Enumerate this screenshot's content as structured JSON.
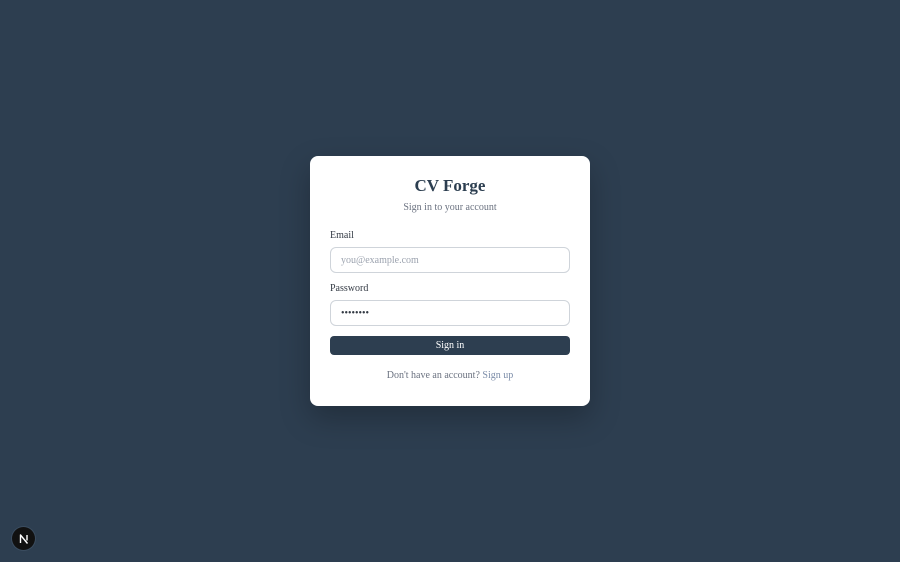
{
  "app": {
    "title": "CV Forge",
    "subtitle": "Sign in to your account"
  },
  "form": {
    "email": {
      "label": "Email",
      "placeholder": "you@example.com",
      "value": ""
    },
    "password": {
      "label": "Password",
      "value": "••••••••"
    },
    "submit_label": "Sign in"
  },
  "footer": {
    "prompt": "Don't have an account?",
    "link_label": "Sign up"
  },
  "dev_badge": {
    "icon": "nextjs-logo-icon",
    "letter": "N"
  },
  "colors": {
    "background": "#2d3e50",
    "card": "#ffffff",
    "button": "#2d3e50",
    "link": "#7b8ca8"
  }
}
